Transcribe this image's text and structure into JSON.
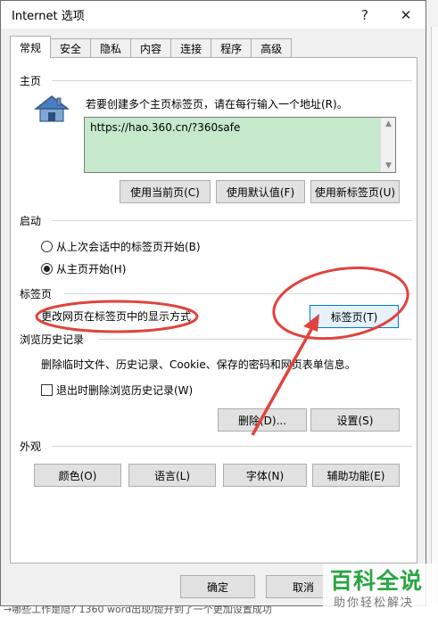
{
  "dialog": {
    "title": "Internet 选项",
    "help_glyph": "?",
    "close_glyph": "✕"
  },
  "tabs": [
    {
      "label": "常规",
      "active": true
    },
    {
      "label": "安全"
    },
    {
      "label": "隐私"
    },
    {
      "label": "内容"
    },
    {
      "label": "连接"
    },
    {
      "label": "程序"
    },
    {
      "label": "高级"
    }
  ],
  "homepage": {
    "section_label": "主页",
    "hint": "若要创建多个主页标签页，请在每行输入一个地址(R)。",
    "url": "https://hao.360.cn/?360safe",
    "btn_current": "使用当前页(C)",
    "btn_default": "使用默认值(F)",
    "btn_newtab": "使用新标签页(U)",
    "url_bg_color": "#c6e9cd"
  },
  "startup": {
    "section_label": "启动",
    "option_last_session": "从上次会话中的标签页开始(B)",
    "option_home": "从主页开始(H)",
    "selected": "option_home"
  },
  "tabs_section": {
    "section_label": "标签页",
    "description": "更改网页在标签页中的显示方式",
    "btn_tabs": "标签页(T)"
  },
  "history": {
    "section_label": "浏览历史记录",
    "description": "删除临时文件、历史记录、Cookie、保存的密码和网页表单信息。",
    "checkbox_label": "退出时删除浏览历史记录(W)",
    "checkbox_checked": false,
    "btn_delete": "删除(D)...",
    "btn_settings": "设置(S)"
  },
  "appearance": {
    "section_label": "外观",
    "btn_colors": "颜色(O)",
    "btn_languages": "语言(L)",
    "btn_fonts": "字体(N)",
    "btn_accessibility": "辅助功能(E)"
  },
  "footer": {
    "btn_ok": "确定",
    "btn_cancel": "取消"
  },
  "background": {
    "bottom_text": "→哪些工作是隐?   1360   word出现/提升到了一个更加设置成功"
  },
  "watermark": {
    "title": "百科全说",
    "subtitle": "助你轻松解决"
  },
  "annotation_color": "#e0443e"
}
